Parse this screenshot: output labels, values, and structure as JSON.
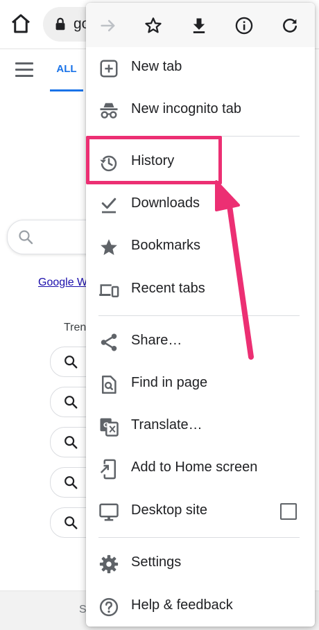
{
  "browser": {
    "url_text": "go",
    "icons": {
      "home": "home-icon",
      "lock": "lock-icon"
    }
  },
  "page": {
    "tab_all_label": "ALL",
    "link_text": "Google W",
    "trending_label": "Tren",
    "footer_text": "S",
    "trend_item_count": 5
  },
  "menu": {
    "toolbar": [
      {
        "name": "forward-icon",
        "enabled": false
      },
      {
        "name": "bookmark-star-icon",
        "enabled": true
      },
      {
        "name": "download-icon",
        "enabled": true
      },
      {
        "name": "page-info-icon",
        "enabled": true
      },
      {
        "name": "reload-icon",
        "enabled": true
      }
    ],
    "items": [
      {
        "label": "New tab",
        "icon": "new-tab-plus-icon"
      },
      {
        "label": "New incognito tab",
        "icon": "incognito-icon"
      },
      {
        "label": "History",
        "icon": "history-icon"
      },
      {
        "label": "Downloads",
        "icon": "downloads-check-icon"
      },
      {
        "label": "Bookmarks",
        "icon": "star-icon"
      },
      {
        "label": "Recent tabs",
        "icon": "recent-tabs-devices-icon"
      },
      {
        "label": "Share…",
        "icon": "share-icon"
      },
      {
        "label": "Find in page",
        "icon": "find-in-page-icon"
      },
      {
        "label": "Translate…",
        "icon": "translate-icon"
      },
      {
        "label": "Add to Home screen",
        "icon": "add-to-home-screen-icon"
      },
      {
        "label": "Desktop site",
        "icon": "desktop-icon",
        "checkbox_checked": false
      },
      {
        "label": "Settings",
        "icon": "settings-gear-icon"
      },
      {
        "label": "Help & feedback",
        "icon": "help-icon"
      }
    ]
  },
  "annotation": {
    "highlighted_item": "History",
    "color": "#ec2f73"
  },
  "colors": {
    "accent": "#1a73e8",
    "icon_gray": "#5f6368",
    "highlight": "#ec2f73"
  }
}
